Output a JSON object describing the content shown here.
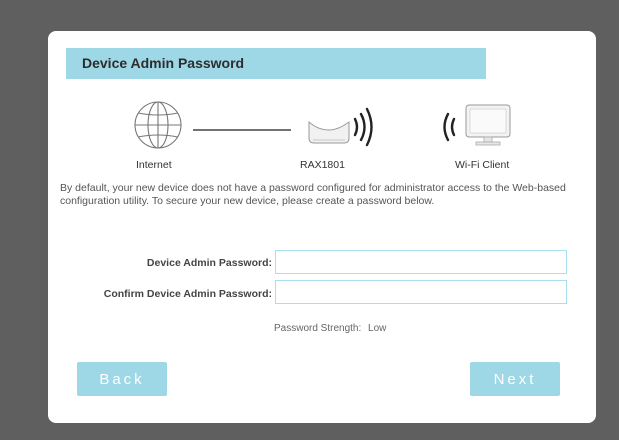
{
  "wizard": {
    "title": "Device Admin Password",
    "diagram": {
      "internet_label": "Internet",
      "router_label": "RAX1801",
      "client_label": "Wi-Fi Client"
    },
    "description": "By default, your new device does not have a password configured for administrator access to the Web-based configuration utility. To secure your new device, please create a password below.",
    "fields": {
      "admin_password_label": "Device Admin Password:",
      "admin_password_value": "",
      "confirm_password_label": "Confirm Device Admin Password:",
      "confirm_password_value": ""
    },
    "strength": {
      "label": "Password Strength:",
      "value": "Low"
    },
    "buttons": {
      "back": "Back",
      "next": "Next"
    }
  },
  "colors": {
    "background": "#5f5f5f",
    "accent": "#9ed7e6",
    "card": "#ffffff"
  },
  "icons": [
    "globe-icon",
    "router-icon",
    "wifi-signal-icon",
    "monitor-icon"
  ]
}
